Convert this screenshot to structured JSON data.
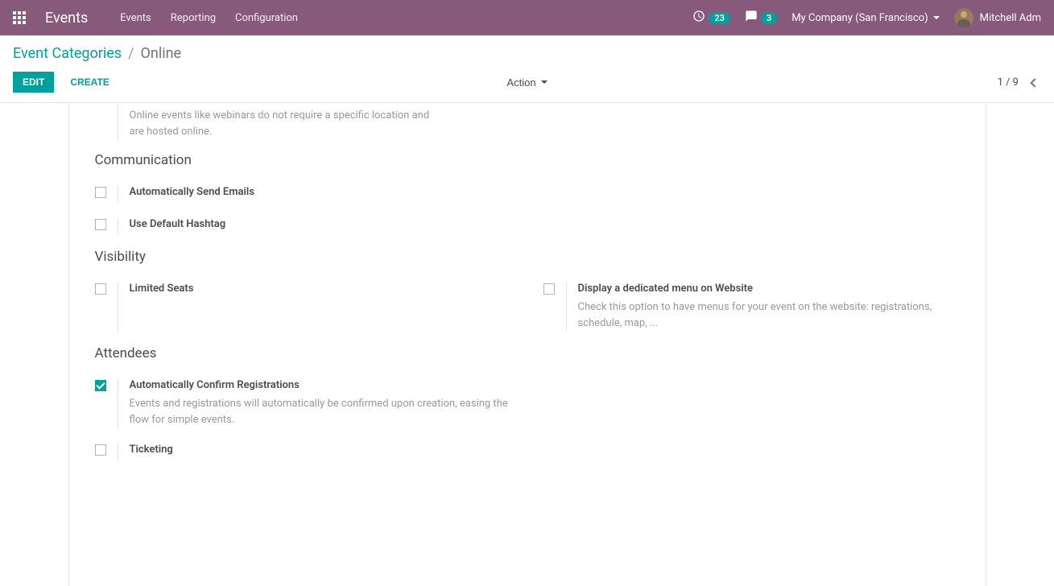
{
  "navbar": {
    "brand": "Events",
    "menu": [
      {
        "label": "Events"
      },
      {
        "label": "Reporting"
      },
      {
        "label": "Configuration"
      }
    ],
    "activity_badge": "23",
    "chat_badge": "3",
    "company": "My Company (San Francisco)",
    "user": "Mitchell Adm"
  },
  "breadcrumb": {
    "parent": "Event Categories",
    "current": "Online"
  },
  "toolbar": {
    "edit": "Edit",
    "create": "Create",
    "action": "Action",
    "pager": "1 / 9"
  },
  "form": {
    "online_help": "Online events like webinars do not require a specific location and are hosted online.",
    "sections": {
      "communication": {
        "title": "Communication",
        "send_emails": "Automatically Send Emails",
        "default_hashtag": "Use Default Hashtag"
      },
      "visibility": {
        "title": "Visibility",
        "limited_seats": "Limited Seats",
        "dedicated_menu": "Display a dedicated menu on Website",
        "dedicated_menu_help": "Check this option to have menus for your event on the website: registrations, schedule, map, ..."
      },
      "attendees": {
        "title": "Attendees",
        "auto_confirm": "Automatically Confirm Registrations",
        "auto_confirm_help": "Events and registrations will automatically be confirmed upon creation, easing the flow for simple events.",
        "ticketing": "Ticketing"
      }
    }
  }
}
